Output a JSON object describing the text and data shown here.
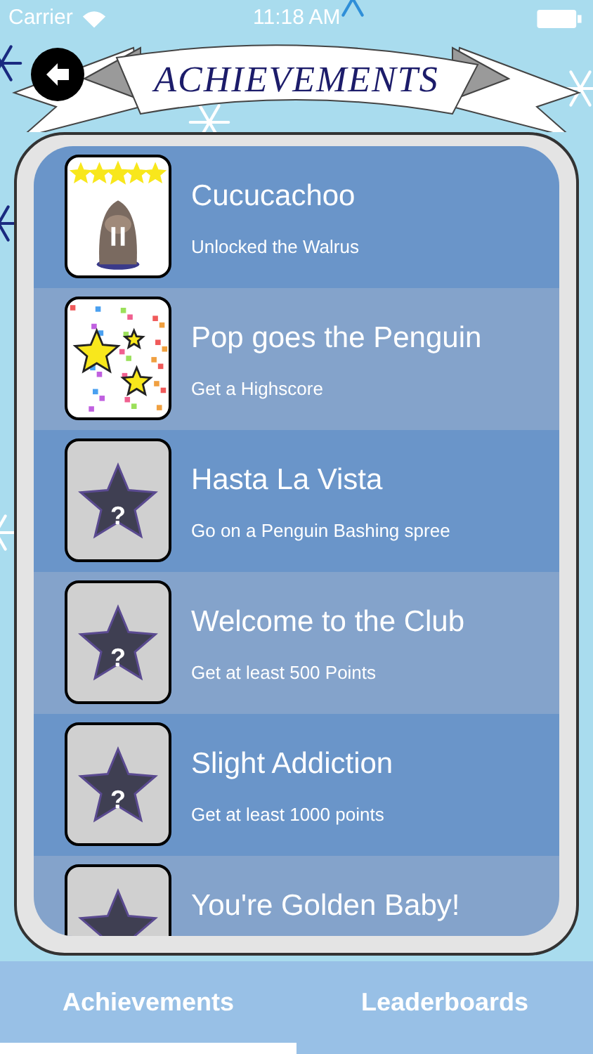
{
  "status_bar": {
    "carrier": "Carrier",
    "time": "11:18 AM"
  },
  "title": "ACHIEVEMENTS",
  "achievements": [
    {
      "kind": "walrus",
      "title": "Cucucachoo",
      "subtitle": "Unlocked the Walrus"
    },
    {
      "kind": "confetti",
      "title": "Pop goes the Penguin",
      "subtitle": "Get a Highscore"
    },
    {
      "kind": "locked",
      "mark": "?",
      "title": "Hasta La Vista",
      "subtitle": "Go on a Penguin Bashing spree"
    },
    {
      "kind": "locked",
      "mark": "?",
      "title": "Welcome to the Club",
      "subtitle": "Get at least 500 Points"
    },
    {
      "kind": "locked",
      "mark": "?",
      "title": "Slight Addiction",
      "subtitle": "Get at least 1000 points"
    },
    {
      "kind": "locked",
      "title": "You're Golden Baby!"
    }
  ],
  "tabs": [
    {
      "label": "Achievements",
      "selected": true
    },
    {
      "label": "Leaderboards",
      "selected": false
    }
  ]
}
